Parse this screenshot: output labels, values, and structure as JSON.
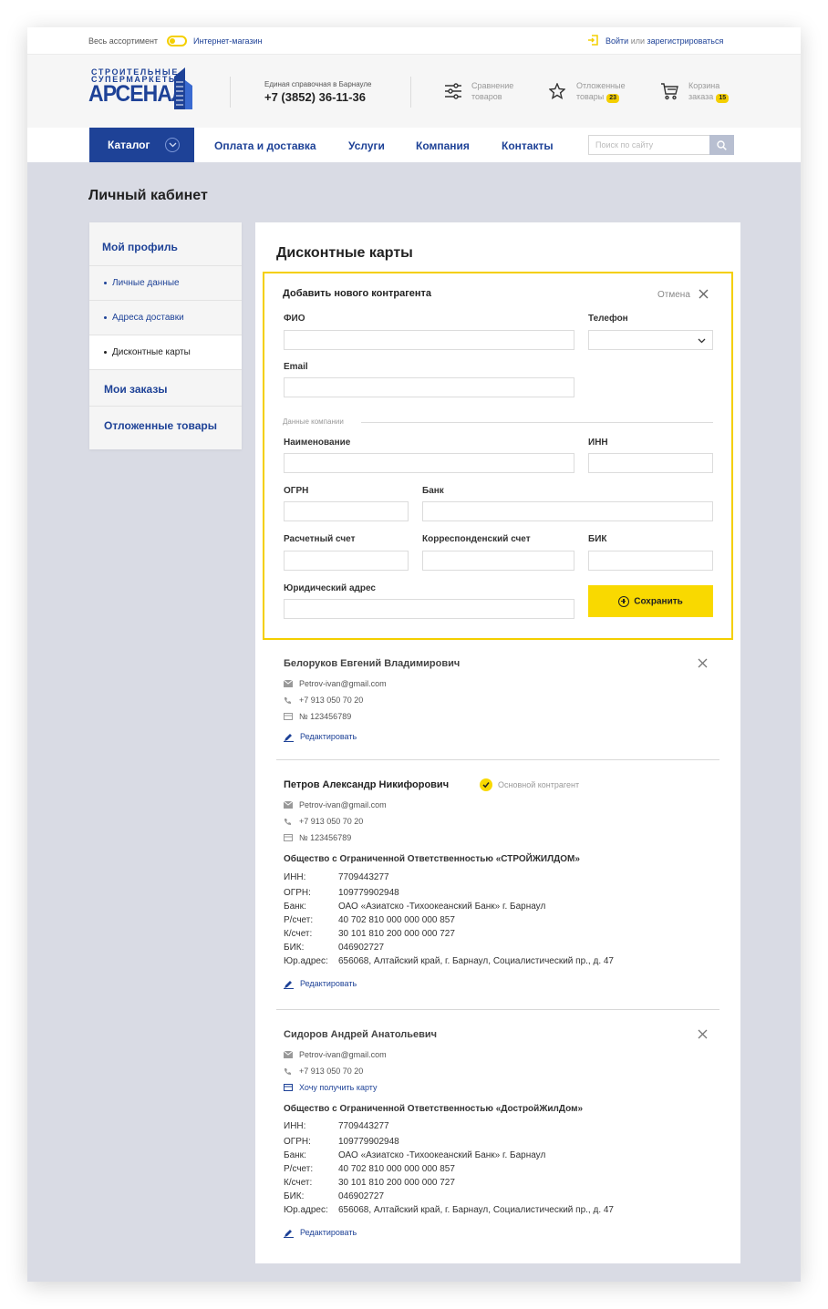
{
  "topbar": {
    "assortment": "Весь ассортимент",
    "shop": "Интернет-магазин",
    "login": "Войти",
    "or": "или",
    "register": "зарегистрироваться"
  },
  "logo": {
    "line1": "СТРОИТЕЛЬНЫЕ",
    "line2": "СУПЕРМАРКЕТЫ",
    "line3": "АРСЕНАЛ"
  },
  "header": {
    "hotline_label": "Единая справочная в Барнауле",
    "hotline_phone": "+7 (3852) 36-11-36",
    "compare_line1": "Сравнение",
    "compare_line2": "товаров",
    "deferred_line1": "Отложенные",
    "deferred_line2": "товары",
    "deferred_count": "23",
    "cart_line1": "Корзина",
    "cart_line2": "заказа",
    "cart_count": "15"
  },
  "nav": {
    "catalog": "Каталог",
    "links": [
      "Оплата и доставка",
      "Услуги",
      "Компания",
      "Контакты"
    ],
    "search_placeholder": "Поиск по сайту"
  },
  "page_title": "Личный кабинет",
  "sidebar": {
    "profile": "Мой профиль",
    "personal": "Личные данные",
    "addresses": "Адреса доставки",
    "cards": "Дисконтные карты",
    "orders": "Мои заказы",
    "deferred": "Отложенные товары"
  },
  "content_title": "Дисконтные карты",
  "form": {
    "heading": "Добавить нового контрагента",
    "cancel": "Отмена",
    "fio": "ФИО",
    "phone": "Телефон",
    "email": "Email",
    "company_data": "Данные компании",
    "name": "Наименование",
    "inn": "ИНН",
    "ogrn": "ОГРН",
    "bank": "Банк",
    "account": "Расчетный счет",
    "corr_account": "Корреспонденский счет",
    "bik": "БИК",
    "legal_address": "Юридический адрес",
    "save": "Сохранить"
  },
  "contacts": [
    {
      "name": "Белоруков Евгений Владимирович",
      "email": "Petrov-ivan@gmail.com",
      "phone": "+7 913 050 70 20",
      "card": "№ 123456789",
      "edit": "Редактировать"
    },
    {
      "name": "Петров Александр Никифорович",
      "main_label": "Основной контрагент",
      "email": "Petrov-ivan@gmail.com",
      "phone": "+7 913 050 70 20",
      "card": "№ 123456789",
      "company": "Общество с Ограниченной Ответственностью «СТРОЙЖИЛДОМ»",
      "requisites": [
        {
          "k": "ИНН:",
          "v": "7709443277"
        },
        {
          "k": "ОГРН:",
          "v": "109779902948"
        },
        {
          "k": "Банк:",
          "v": "ОАО «Азиатско -Тихоокеанский Банк» г. Барнаул"
        },
        {
          "k": "Р/счет:",
          "v": "40 702 810 000 000 000 857"
        },
        {
          "k": "К/счет:",
          "v": "30 101 810 200 000 000 727"
        },
        {
          "k": "БИК:",
          "v": "046902727"
        },
        {
          "k": "Юр.адрес:",
          "v": "656068, Алтайский край, г. Барнаул, Социалистический пр., д. 47"
        }
      ],
      "edit": "Редактировать"
    },
    {
      "name": "Сидоров Андрей Анатольевич",
      "email": "Petrov-ivan@gmail.com",
      "phone": "+7 913 050 70 20",
      "card_request": "Хочу получить карту",
      "company": "Общество с Ограниченной Ответственностью «ДостройЖилДом»",
      "requisites": [
        {
          "k": "ИНН:",
          "v": "7709443277"
        },
        {
          "k": "ОГРН:",
          "v": "109779902948"
        },
        {
          "k": "Банк:",
          "v": "ОАО «Азиатско -Тихоокеанский Банк» г. Барнаул"
        },
        {
          "k": "Р/счет:",
          "v": "40 702 810 000 000 000 857"
        },
        {
          "k": "К/счет:",
          "v": "30 101 810 200 000 000 727"
        },
        {
          "k": "БИК:",
          "v": "046902727"
        },
        {
          "k": "Юр.адрес:",
          "v": "656068, Алтайский край, г. Барнаул, Социалистический пр., д. 47"
        }
      ],
      "edit": "Редактировать"
    }
  ],
  "colors": {
    "brand_blue": "#1e4297",
    "accent_yellow": "#f9d900",
    "page_bg": "#d9dbe4"
  },
  "icons": [
    "login-icon",
    "compare-icon",
    "star-icon",
    "cart-icon",
    "chevron-down-icon",
    "search-icon",
    "close-icon",
    "mail-icon",
    "phone-icon",
    "card-icon",
    "pencil-icon",
    "check-icon",
    "plus-circle-icon"
  ]
}
